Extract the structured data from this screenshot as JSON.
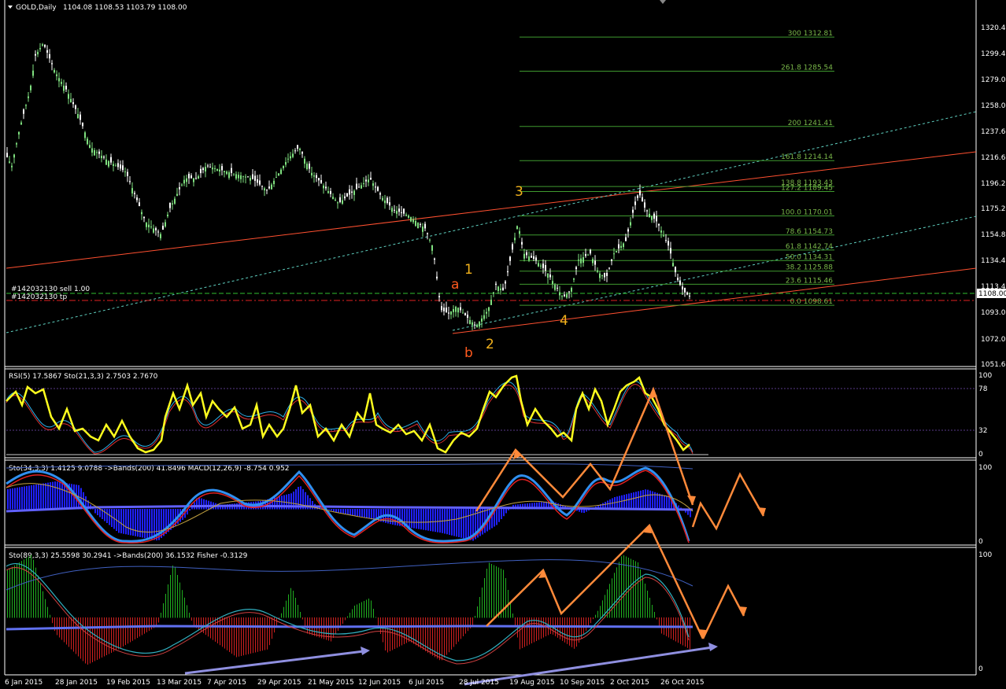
{
  "window": {
    "title": "GOLD,Daily",
    "ohlc": "1104.08 1108.53 1103.79 1108.00",
    "current_price": "1108.00"
  },
  "price_axis": [
    "1320.40",
    "1299.40",
    "1279.00",
    "1258.00",
    "1237.60",
    "1216.60",
    "1196.20",
    "1175.20",
    "1154.80",
    "1134.40",
    "1113.40",
    "1093.00",
    "1072.00",
    "1051.60"
  ],
  "fibonacci": [
    {
      "text": "300  1312.81",
      "price": 1312.81
    },
    {
      "text": "261.8  1285.54",
      "price": 1285.54
    },
    {
      "text": "200  1241.41",
      "price": 1241.41
    },
    {
      "text": "161.8  1214.14",
      "price": 1214.14
    },
    {
      "text": "138.8  1193.43",
      "price": 1193.43
    },
    {
      "text": "127.2  1189.45",
      "price": 1189.45
    },
    {
      "text": "100.0  1170.01",
      "price": 1170.01
    },
    {
      "text": "78.6  1154.73",
      "price": 1154.73
    },
    {
      "text": "61.8  1142.74",
      "price": 1142.74
    },
    {
      "text": "50.0  1134.31",
      "price": 1134.31
    },
    {
      "text": "38.2  1125.88",
      "price": 1125.88
    },
    {
      "text": "23.6  1115.46",
      "price": 1115.46
    },
    {
      "text": "0.0  1098.61",
      "price": 1098.61
    }
  ],
  "orders": {
    "sell": "#142032130 sell 1.00",
    "tp": "#142032130 tp"
  },
  "wave_labels": [
    {
      "text": "1",
      "color": "#f2b21c"
    },
    {
      "text": "a",
      "color": "#ff5a1e"
    },
    {
      "text": "2",
      "color": "#f2b21c"
    },
    {
      "text": "b",
      "color": "#ff5a1e"
    },
    {
      "text": "3",
      "color": "#f2b21c"
    },
    {
      "text": "4",
      "color": "#f2b21c"
    }
  ],
  "indicators": {
    "rsi": {
      "header": "RSI(5) 17.5867   Sto(21,3,3) 2.7503 2.7670",
      "levels": [
        "100",
        "78",
        "32",
        "0"
      ]
    },
    "macd": {
      "header": "Sto(34,3,3) 1.4125 9.0788  ->Bands(200) 41.8496   MACD(12,26,9) -8.754 0.952",
      "levels": [
        "100",
        "0"
      ]
    },
    "fisher": {
      "header": "Sto(89,3,3) 25.5598 30.2941  ->Bands(200) 36.1532   Fisher -0.3129",
      "levels": [
        "100",
        "0"
      ]
    }
  },
  "date_axis": [
    "6 Jan 2015",
    "28 Jan 2015",
    "19 Feb 2015",
    "13 Mar 2015",
    "7 Apr 2015",
    "29 Apr 2015",
    "21 May 2015",
    "12 Jun 2015",
    "6 Jul 2015",
    "28 Jul 2015",
    "19 Aug 2015",
    "10 Sep 2015",
    "2 Oct 2015",
    "26 Oct 2015"
  ],
  "colors": {
    "bull_candle": "#7fe07f",
    "channel_red": "#ff5030",
    "channel_dotted": "#5fd0c0",
    "fib_line": "#3f9a2f",
    "rsi_line": "#ffff1e",
    "annotation_orange": "#ff8a3a",
    "annotation_purple": "#8f8fe0"
  }
}
